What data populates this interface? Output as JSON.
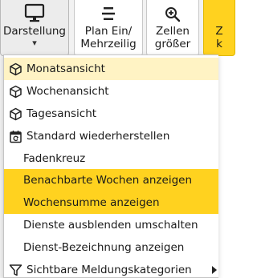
{
  "toolbar": {
    "darstellung": {
      "label": "Darstellung",
      "icon": "monitor-icon",
      "caret": "▾"
    },
    "plan": {
      "line1": "Plan Ein/",
      "line2": "Mehrzeilig",
      "icon": "split-rows-icon"
    },
    "zellen": {
      "line1": "Zellen",
      "line2": "größer",
      "icon": "zoom-in-icon"
    },
    "partial": {
      "line1": "Z",
      "line2": "k",
      "accent": "#ffd21f"
    }
  },
  "menu": {
    "items": [
      {
        "label": "Monatsansicht",
        "icon": "cube-icon",
        "state": "hover"
      },
      {
        "label": "Wochenansicht",
        "icon": "cube-icon"
      },
      {
        "label": "Tagesansicht",
        "icon": "cube-icon"
      },
      {
        "label": "Standard wiederherstellen",
        "icon": "calendar-reset-icon"
      },
      {
        "label": "Fadenkreuz"
      },
      {
        "label": "Benachbarte Wochen anzeigen",
        "state": "active"
      },
      {
        "label": "Wochensumme anzeigen",
        "state": "active"
      },
      {
        "label": "Dienste ausblenden umschalten"
      },
      {
        "label": "Dienst-Bezeichnung anzeigen"
      },
      {
        "label": "Sichtbare Meldungskategorien",
        "icon": "filter-icon",
        "submenu": true
      }
    ]
  },
  "colors": {
    "accent": "#ffd21f",
    "hover": "#fff3c4"
  }
}
